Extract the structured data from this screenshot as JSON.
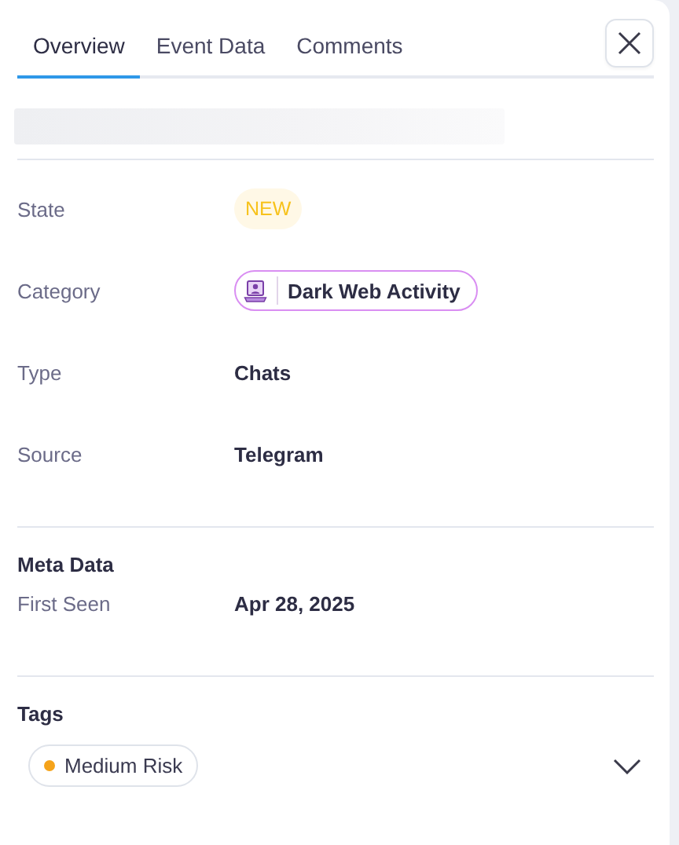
{
  "tabs": [
    {
      "label": "Overview",
      "selected": true
    },
    {
      "label": "Event Data",
      "selected": false
    },
    {
      "label": "Comments",
      "selected": false
    }
  ],
  "fields": [
    {
      "label": "State",
      "kind": "badge",
      "value": "NEW"
    },
    {
      "label": "Category",
      "kind": "chip",
      "value": "Dark Web Activity"
    },
    {
      "label": "Type",
      "kind": "text",
      "value": "Chats"
    },
    {
      "label": "Source",
      "kind": "text",
      "value": "Telegram"
    }
  ],
  "meta_data": {
    "title": "Meta Data",
    "fields": [
      {
        "label": "First Seen",
        "value": "Apr 28, 2025"
      }
    ]
  },
  "tags": {
    "title": "Tags",
    "expanded": false,
    "items": [
      {
        "label": "Medium Risk",
        "color": "#f5a31a"
      }
    ]
  }
}
